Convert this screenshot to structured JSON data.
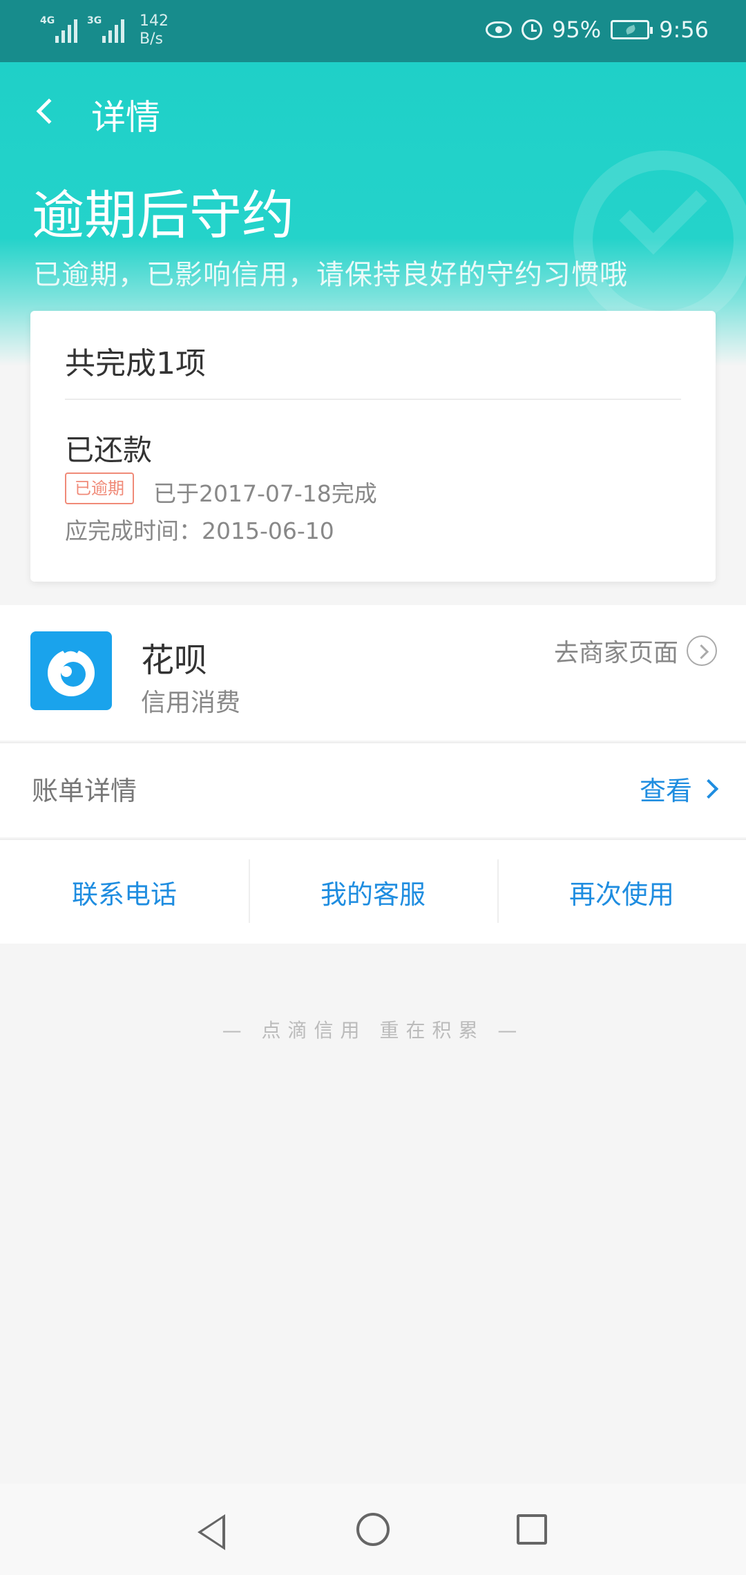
{
  "status_bar": {
    "net1": "4G",
    "net2": "3G",
    "speed_value": "142",
    "speed_unit": "B/s",
    "battery": "95%",
    "time": "9:56",
    "icons": [
      "eye-icon",
      "alarm-icon",
      "battery-icon"
    ]
  },
  "header": {
    "nav_title": "详情",
    "title": "逾期后守约",
    "subtitle": "已逾期，已影响信用，请保持良好的守约习惯哦"
  },
  "card": {
    "summary": "共完成1项",
    "item_title": "已还款",
    "tag": "已逾期",
    "completed": "已于2017-07-18完成",
    "due": "应完成时间：2015-06-10"
  },
  "merchant": {
    "name": "花呗",
    "desc": "信用消费",
    "link": "去商家页面"
  },
  "bill": {
    "label": "账单详情",
    "action": "查看"
  },
  "actions": [
    "联系电话",
    "我的客服",
    "再次使用"
  ],
  "footer": {
    "slogan": "— 点滴信用 重在积累 —"
  },
  "colors": {
    "status_bar": "#178c8c",
    "header": "#24d3ca",
    "link": "#1f8de0",
    "tag": "#f08a78",
    "logo": "#1aa3ec"
  }
}
